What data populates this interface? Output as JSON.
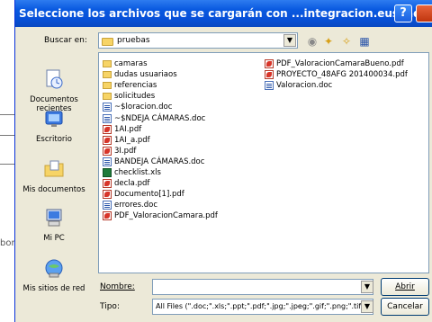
{
  "background": {
    "fragment_text": "bor"
  },
  "window": {
    "title": "Seleccione los archivos que se cargarán con ...integracion.euskadi.ejiedes.net"
  },
  "lookin": {
    "label": "Buscar en:",
    "value": "pruebas"
  },
  "places": [
    {
      "label": "Documentos recientes",
      "icon": "recent-documents-icon"
    },
    {
      "label": "Escritorio",
      "icon": "desktop-icon"
    },
    {
      "label": "Mis documentos",
      "icon": "my-documents-icon"
    },
    {
      "label": "Mi PC",
      "icon": "my-computer-icon"
    },
    {
      "label": "Mis sitios de red",
      "icon": "network-places-icon"
    }
  ],
  "files": {
    "column1": [
      {
        "name": "camaras",
        "type": "folder"
      },
      {
        "name": "dudas usuariaos",
        "type": "folder"
      },
      {
        "name": "referencias",
        "type": "folder"
      },
      {
        "name": "solicitudes",
        "type": "folder"
      },
      {
        "name": "~$loracion.doc",
        "type": "doc"
      },
      {
        "name": "~$NDEJA CÁMARAS.doc",
        "type": "doc"
      },
      {
        "name": "1AI.pdf",
        "type": "pdf"
      },
      {
        "name": "1AI_a.pdf",
        "type": "pdf"
      },
      {
        "name": "3I.pdf",
        "type": "pdf"
      },
      {
        "name": "BANDEJA CÁMARAS.doc",
        "type": "doc"
      },
      {
        "name": "checklist.xls",
        "type": "xls"
      },
      {
        "name": "decla.pdf",
        "type": "pdf"
      },
      {
        "name": "Documento[1].pdf",
        "type": "pdf"
      },
      {
        "name": "errores.doc",
        "type": "doc"
      },
      {
        "name": "PDF_ValoracionCamara.pdf",
        "type": "pdf"
      }
    ],
    "column2": [
      {
        "name": "PDF_ValoracionCamaraBueno.pdf",
        "type": "pdf"
      },
      {
        "name": "PROYECTO_48AFG 201400034.pdf",
        "type": "pdf"
      },
      {
        "name": "Valoracion.doc",
        "type": "doc"
      }
    ]
  },
  "filename": {
    "label": "Nombre:",
    "value": ""
  },
  "filetype": {
    "label": "Tipo:",
    "value": "All Files (\".doc;\".xls;\".ppt;\".pdf;\".jpg;\".jpeg;\".gif;\".png;\".tif;\".tiff)"
  },
  "buttons": {
    "open": "Abrir",
    "cancel": "Cancelar"
  }
}
